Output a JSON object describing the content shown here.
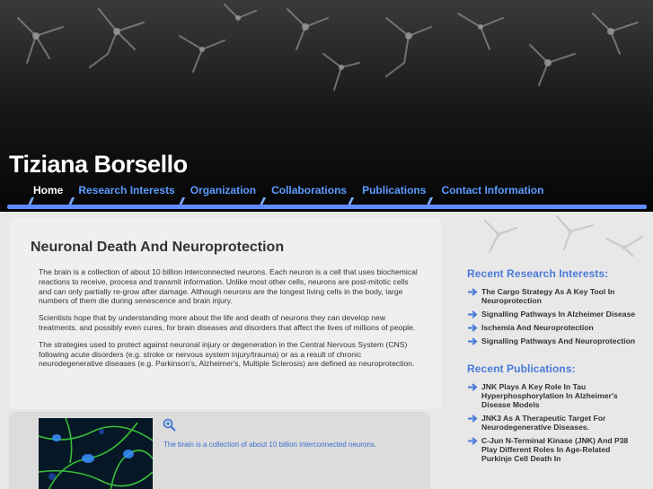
{
  "site": {
    "title": "Tiziana Borsello"
  },
  "nav": {
    "items": [
      {
        "label": "Home",
        "active": true
      },
      {
        "label": "Research Interests",
        "active": false
      },
      {
        "label": "Organization",
        "active": false
      },
      {
        "label": "Collaborations",
        "active": false
      },
      {
        "label": "Publications",
        "active": false
      },
      {
        "label": "Contact Information",
        "active": false
      }
    ]
  },
  "article": {
    "title": "Neuronal Death And Neuroprotection",
    "paragraphs": [
      "The brain is a collection of about 10 billion interconnected neurons. Each neuron is a cell that uses biochemical reactions to receive, process and transmit information. Unlike most other cells, neurons are post-mitotic cells and can only partially re-grow after damage. Although neurons are the longest living cells in the body, large numbers of them die during senescence and brain injury.",
      "Scientists hope that by understanding more about the life and death of neurons they can develop new treatments, and possibly even cures, for brain diseases and disorders that affect the lives of millions of people.",
      "The strategies used to protect against neuronal injury or degeneration in the Central Nervous System (CNS) following acute disorders (e.g. stroke or nervous system injury/trauma) or as a result of chronic neurodegenerative diseases (e.g. Parkinson's, Alzheimer's, Multiple Sclerosis) are defined as neuroprotection."
    ],
    "image_caption": "The brain is a collection of about 10 billion interconnected neurons."
  },
  "sidebar": {
    "research_heading": "Recent Research Interests:",
    "research_items": [
      "The Cargo Strategy As A Key Tool In Neuroprotection",
      "Signalling Pathways In Alzheimer Disease",
      "Ischemia And Neuroprotection",
      "Signalling Pathways And Neuroprotection"
    ],
    "publications_heading": "Recent Publications:",
    "publication_items": [
      "JNK Plays A Key Role In Tau Hyperphosphorylation In Alzheimer's Disease Models",
      "JNK3 As A Therapeutic Target For Neurodegenerative Diseases.",
      "C-Jun N-Terminal Kinase (JNK) And P38 Play Different Roles In Age-Related Purkinje Cell Death In"
    ]
  },
  "colors": {
    "accent": "#5e8cff",
    "link": "#4a7ad8",
    "nav_link": "#5b9cff"
  },
  "icons": [
    "zoom-in-icon",
    "arrow-right-icon"
  ]
}
